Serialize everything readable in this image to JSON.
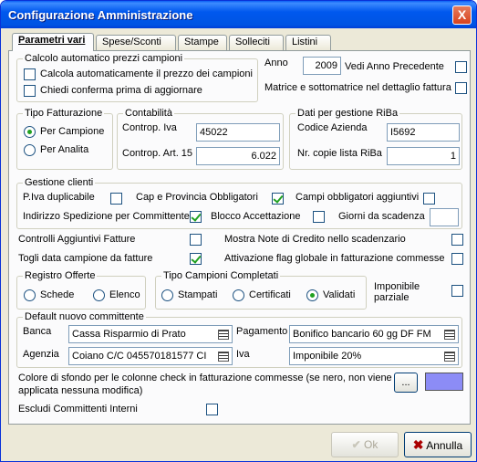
{
  "window": {
    "title": "Configurazione Amministrazione",
    "close": "X"
  },
  "tabs": [
    "Parametri vari",
    "Spese/Sconti",
    "Stampe",
    "Solleciti",
    "Listini"
  ],
  "prezzi": {
    "legend": "Calcolo automatico prezzi campioni",
    "calcola": "Calcola automaticamente il prezzo dei campioni",
    "chiedi": "Chiedi conferma prima di aggiornare",
    "calcola_checked": false,
    "chiedi_checked": false
  },
  "anno": {
    "label": "Anno",
    "value": "2009",
    "vedi": "Vedi Anno Precedente",
    "vedi_checked": false,
    "matrice": "Matrice e sottomatrice nel dettaglio fattura",
    "matrice_checked": false
  },
  "tipo_fatt": {
    "legend": "Tipo Fatturazione",
    "campione": "Per Campione",
    "analita": "Per Analita",
    "selected": "Per Campione"
  },
  "contabilita": {
    "legend": "Contabilità",
    "iva_label": "Controp. Iva",
    "iva_value": "45022",
    "art15_label": "Controp. Art. 15",
    "art15_value": "6.022"
  },
  "riba": {
    "legend": "Dati per gestione RiBa",
    "codice_label": "Codice Azienda",
    "codice_value": "I5692",
    "copie_label": "Nr. copie lista RiBa",
    "copie_value": "1"
  },
  "clienti": {
    "legend": "Gestione clienti",
    "piva": "P.Iva duplicabile",
    "piva_checked": false,
    "cap": "Cap e Provincia Obbligatori",
    "cap_checked": true,
    "campi": "Campi obbligatori aggiuntivi",
    "campi_checked": false,
    "indirizzo": "Indirizzo Spedizione per Committente",
    "indirizzo_checked": true,
    "blocco": "Blocco Accettazione",
    "blocco_checked": false,
    "giorni": "Giorni da scadenza",
    "giorni_value": ""
  },
  "opzioni": {
    "controlli": "Controlli Aggiuntivi Fatture",
    "controlli_checked": false,
    "note": "Mostra Note di Credito nello scadenzario",
    "note_checked": false,
    "togli": "Togli data campione da fatture",
    "togli_checked": true,
    "attivazione": "Attivazione flag globale in fatturazione commesse",
    "attivazione_checked": false
  },
  "registro": {
    "legend": "Registro Offerte",
    "schede": "Schede",
    "elenco": "Elenco",
    "selected": ""
  },
  "tipo_campioni": {
    "legend": "Tipo Campioni Completati",
    "stampati": "Stampati",
    "certificati": "Certificati",
    "validati": "Validati",
    "selected": "Validati"
  },
  "imponibile": {
    "label": "Imponibile parziale",
    "checked": false
  },
  "committente": {
    "legend": "Default nuovo committente",
    "banca_label": "Banca",
    "banca_value": "Cassa Risparmio di Prato",
    "pagamento_label": "Pagamento",
    "pagamento_value": "Bonifico bancario 60 gg DF FM",
    "agenzia_label": "Agenzia",
    "agenzia_value": "Coiano C/C 045570181577  CI",
    "iva_label": "Iva",
    "iva_value": "Imponibile 20%"
  },
  "colore": {
    "label": "Colore di sfondo per le colonne check in fatturazione commesse (se nero, non viene applicata nessuna modifica)",
    "button": "...",
    "color": "#8c8cf6"
  },
  "escludi": {
    "label": "Escludi Committenti Interni",
    "checked": false
  },
  "buttons": {
    "ok": "Ok",
    "annulla": "Annulla"
  }
}
